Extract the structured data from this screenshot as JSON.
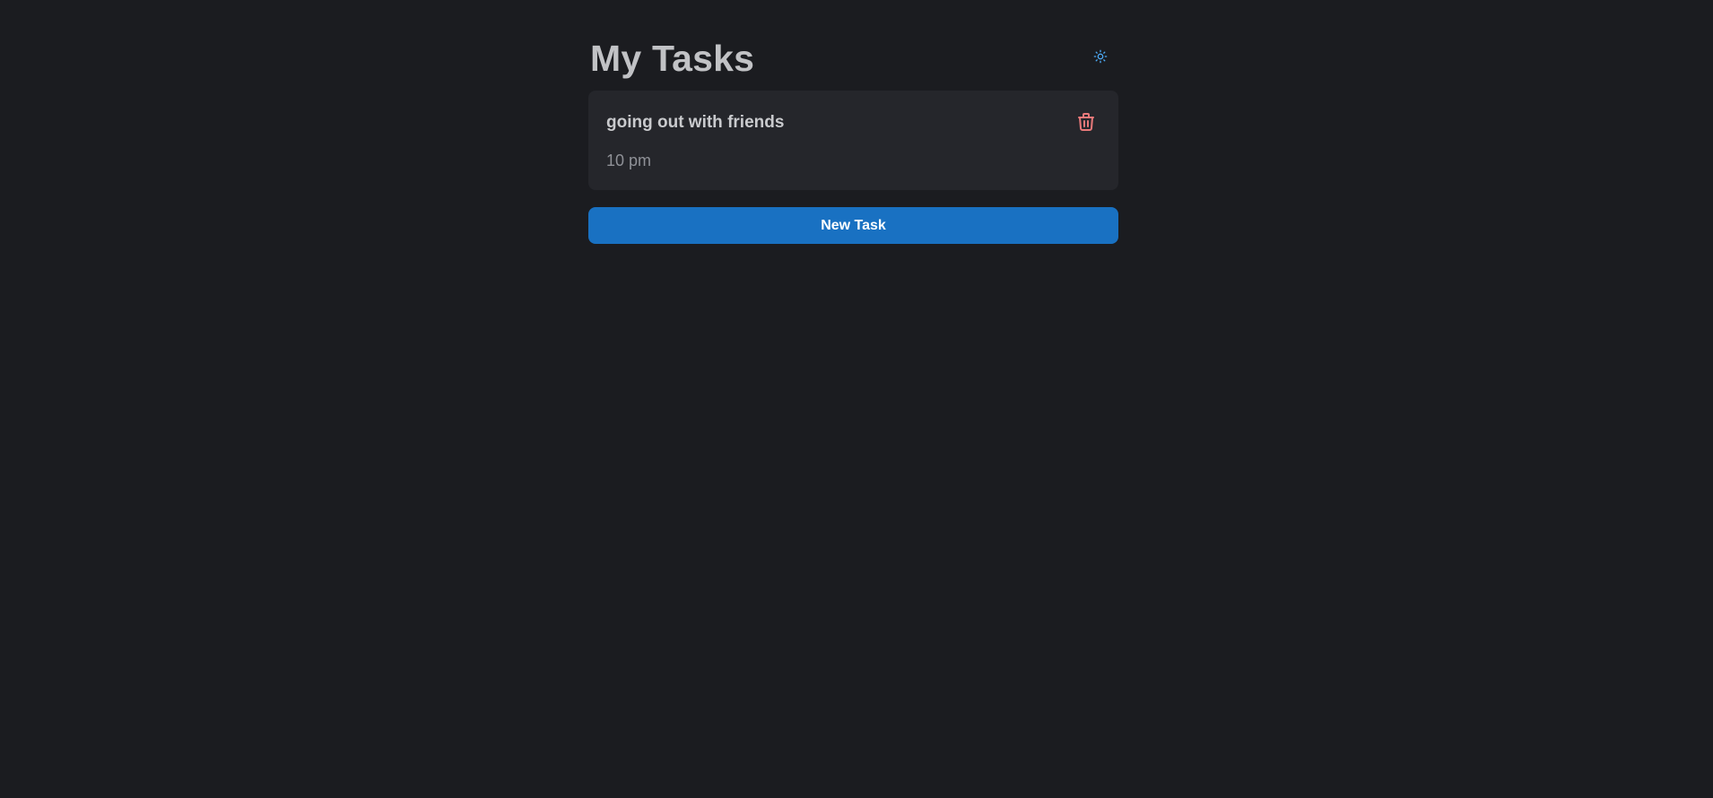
{
  "header": {
    "title": "My Tasks",
    "theme_toggle_icon": "sun-icon"
  },
  "tasks": [
    {
      "title": "going out with friends",
      "time": "10 pm",
      "delete_icon": "trash-icon"
    }
  ],
  "actions": {
    "new_task_label": "New Task"
  },
  "colors": {
    "background": "#1b1c20",
    "card": "#25262b",
    "accent": "#1971c2",
    "delete": "#e8797a",
    "toggle": "#4dabf7"
  }
}
